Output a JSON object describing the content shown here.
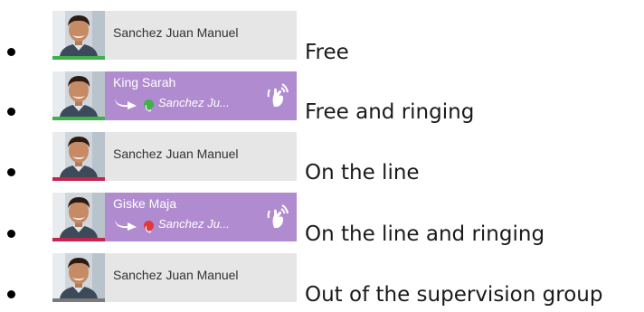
{
  "colors": {
    "free": "#3fb04a",
    "on_line": "#c4244e",
    "out_of_group": "#7a7a7a",
    "ringing_bg": "#b18bd0",
    "idle_bg": "#e6e6e6"
  },
  "items": [
    {
      "name": "Sanchez Juan Manuel",
      "state_label": "Free"
    },
    {
      "name": "King Sarah",
      "caller": "Sanchez Ju...",
      "state_label": "Free and ringing",
      "icons": [
        "call-transfer-arrow-icon",
        "phone-icon",
        "ringing-hand-icon"
      ]
    },
    {
      "name": "Sanchez Juan Manuel",
      "state_label": "On the line"
    },
    {
      "name": "Giske Maja",
      "caller": "Sanchez Ju...",
      "state_label": "On the line and ringing",
      "icons": [
        "call-transfer-arrow-icon",
        "phone-icon",
        "ringing-hand-icon"
      ]
    },
    {
      "name": "Sanchez Juan Manuel",
      "state_label": "Out of the supervision group"
    }
  ]
}
